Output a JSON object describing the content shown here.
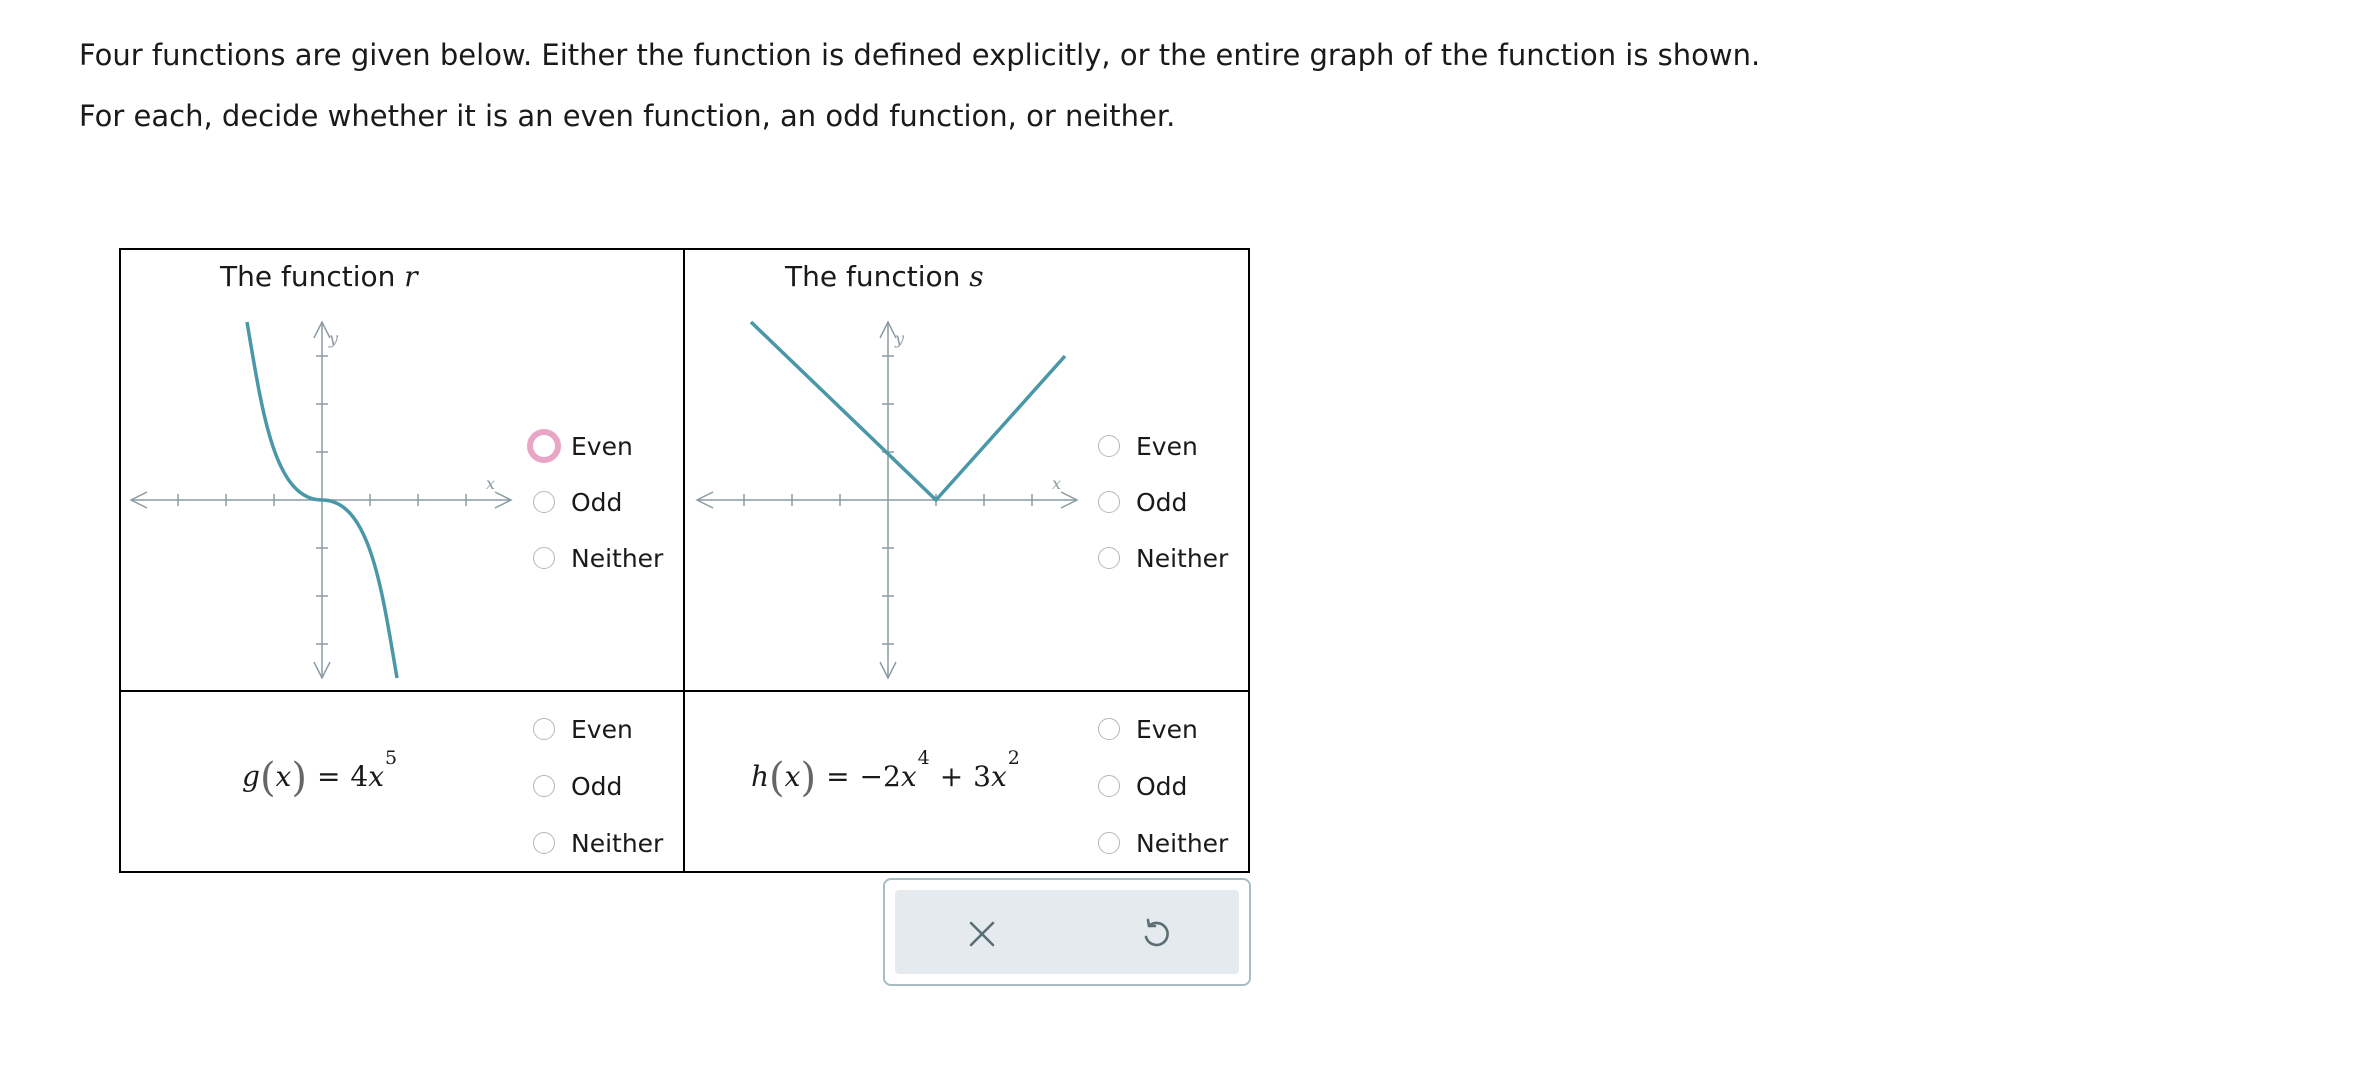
{
  "instructions": {
    "line1": "Four functions are given below. Either the function is defined explicitly, or the entire graph of the function is shown.",
    "line2": "For each, decide whether it is an even function, an odd function, or neither."
  },
  "options": [
    "Even",
    "Odd",
    "Neither"
  ],
  "cells": [
    {
      "title_prefix": "The function ",
      "name": "r",
      "selected": ""
    },
    {
      "title_prefix": "The function ",
      "name": "s",
      "selected": ""
    },
    {
      "fname": "g",
      "var": "x",
      "equals": "=",
      "coef": "4",
      "exp": "5",
      "selected": ""
    },
    {
      "fname": "h",
      "var": "x",
      "equals": "=",
      "term1": "−2",
      "exp1": "4",
      "plus": "+",
      "term2": "3",
      "exp2": "2",
      "selected": ""
    }
  ],
  "graphs": {
    "axis_x_label": "x",
    "axis_y_label": "y",
    "r": {
      "description_points": [
        [
          -1.6,
          3.6
        ],
        [
          -1.2,
          1.4
        ],
        [
          -0.8,
          0.3
        ],
        [
          0,
          0
        ],
        [
          0.8,
          -0.3
        ],
        [
          1.2,
          -1.4
        ],
        [
          1.6,
          -3.6
        ]
      ]
    },
    "s": {
      "vertex": [
        1,
        0
      ],
      "left_end": [
        -3,
        3.6
      ],
      "right_end": [
        3,
        2.9
      ]
    }
  },
  "focused_option": {
    "cell": 0,
    "option": "Even"
  },
  "toolbar": {
    "clear_icon": "close-icon",
    "undo_icon": "undo-icon"
  },
  "colors": {
    "curve": "#4a97a9",
    "axis": "#8a9ca3",
    "focus_ring": "#e8a5c6",
    "toolbar_bg": "#e4eaed"
  }
}
